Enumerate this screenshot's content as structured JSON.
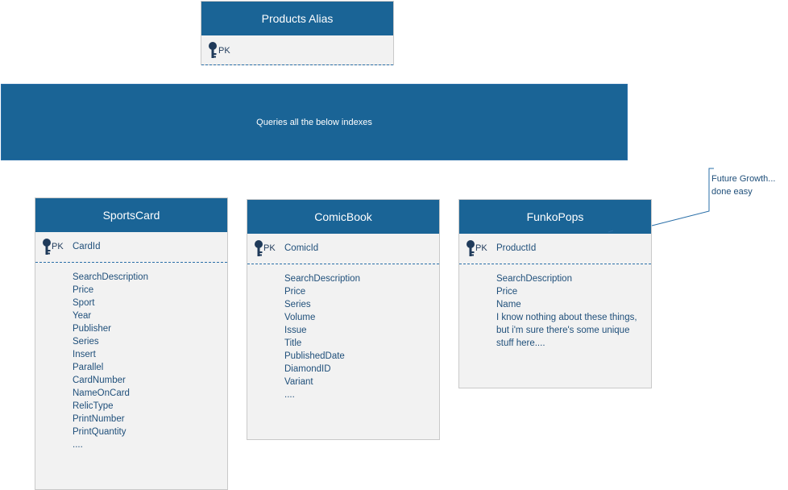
{
  "products_alias": {
    "title": "Products Alias",
    "pk_label": "PK"
  },
  "banner": {
    "text": "Queries all the below indexes"
  },
  "entities": [
    {
      "title": "SportsCard",
      "pk_label": "PK",
      "pk_field": "CardId",
      "fields": [
        "SearchDescription",
        "Price",
        "Sport",
        "Year",
        "Publisher",
        "Series",
        "Insert",
        "Parallel",
        "CardNumber",
        "NameOnCard",
        "RelicType",
        "PrintNumber",
        "PrintQuantity",
        "...."
      ]
    },
    {
      "title": "ComicBook",
      "pk_label": "PK",
      "pk_field": "ComicId",
      "fields": [
        "SearchDescription",
        "Price",
        "Series",
        "Volume",
        "Issue",
        "Title",
        "PublishedDate",
        "DiamondID",
        "Variant",
        "...."
      ]
    },
    {
      "title": "FunkoPops",
      "pk_label": "PK",
      "pk_field": "ProductId",
      "fields": [
        "SearchDescription",
        "Price",
        "Name",
        "I know nothing about these things, but i'm sure there's some unique stuff here...."
      ]
    }
  ],
  "annotation": {
    "text": "Future Growth... done easy"
  },
  "icons": {
    "key": "key-icon"
  },
  "colors": {
    "header": "#1a6496",
    "body": "#f2f2f2",
    "text": "#1f4f7a"
  }
}
